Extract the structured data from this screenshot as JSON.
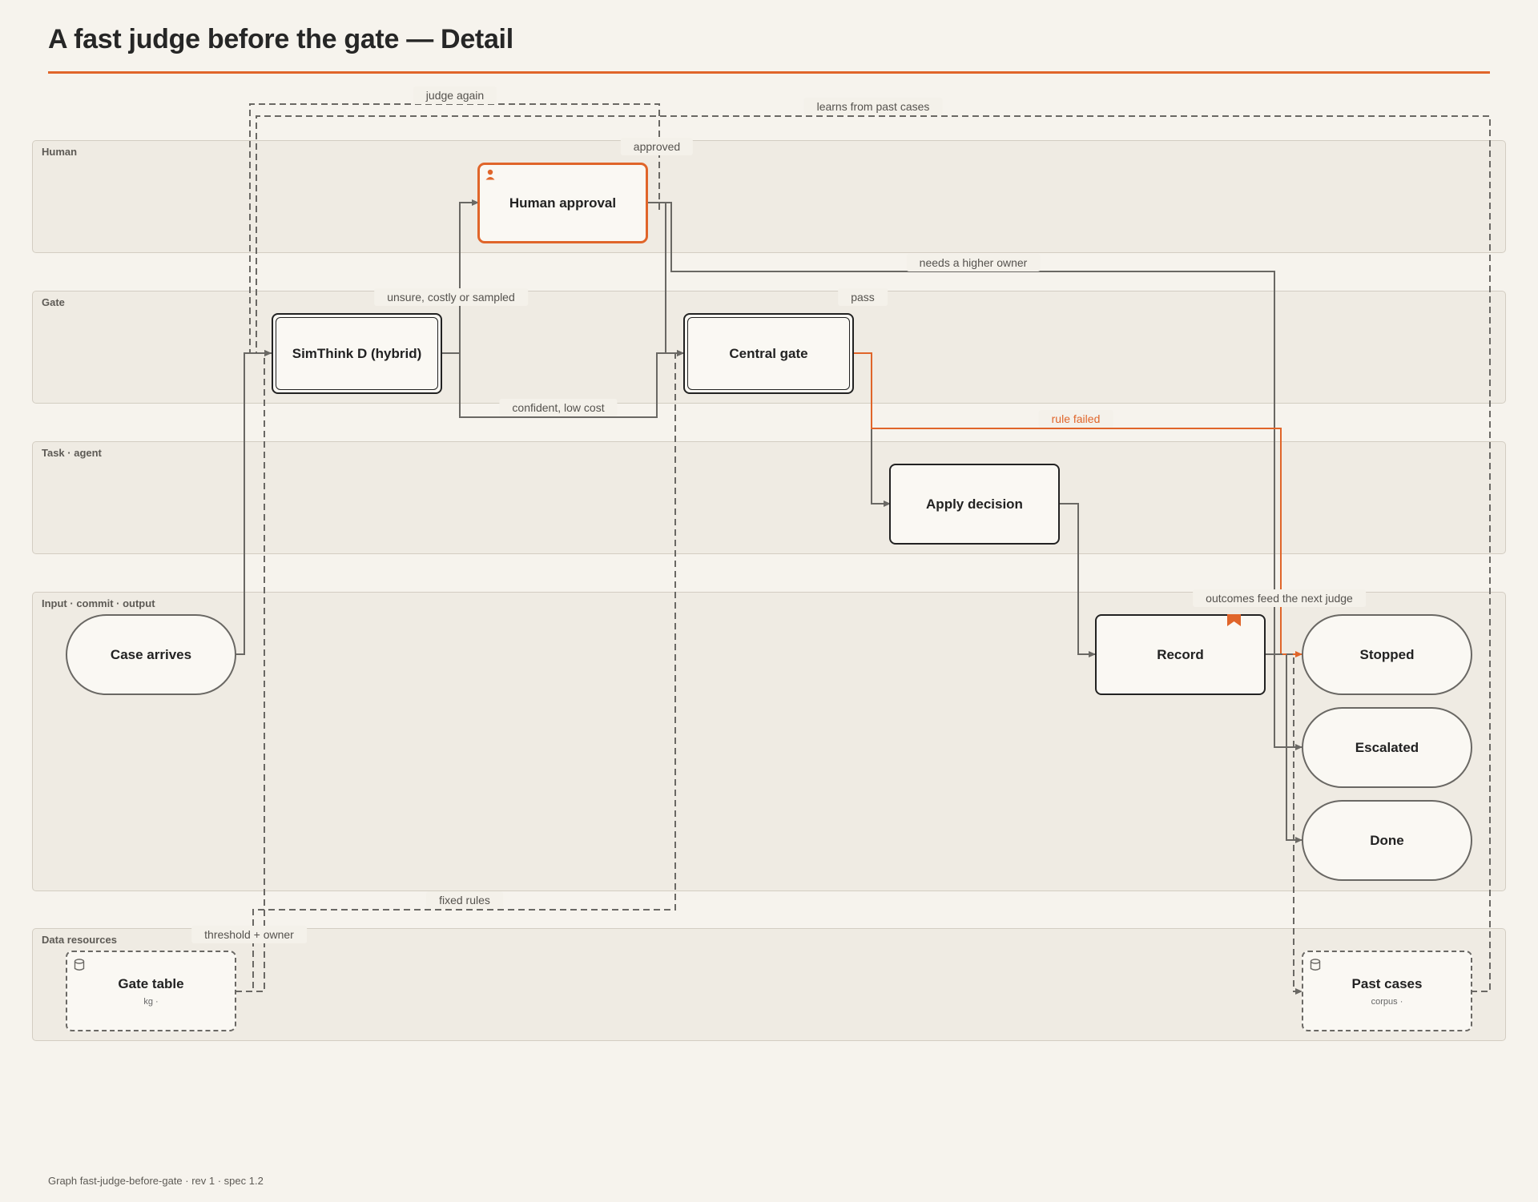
{
  "title": "A fast judge before the gate — Detail",
  "footer": "Graph fast-judge-before-gate · rev 1 · spec 1.2",
  "colors": {
    "accent": "#e0652a",
    "edge": "#6a6864",
    "lane": "#efebe3",
    "background": "#f6f3ed"
  },
  "lanes": [
    {
      "id": "human",
      "label": "Human"
    },
    {
      "id": "gate",
      "label": "Gate"
    },
    {
      "id": "task",
      "label": "Task · agent"
    },
    {
      "id": "io",
      "label": "Input · commit · output"
    },
    {
      "id": "data",
      "label": "Data resources"
    }
  ],
  "nodes": {
    "human_approval": {
      "label": "Human approval",
      "icon": "person-icon"
    },
    "simthink": {
      "label": "SimThink D (hybrid)"
    },
    "central_gate": {
      "label": "Central gate"
    },
    "apply_decision": {
      "label": "Apply decision"
    },
    "case_arrives": {
      "label": "Case arrives"
    },
    "record": {
      "label": "Record",
      "icon": "bookmark-icon"
    },
    "stopped": {
      "label": "Stopped"
    },
    "escalated": {
      "label": "Escalated"
    },
    "done": {
      "label": "Done"
    },
    "gate_table": {
      "label": "Gate table",
      "sub": "kg ·",
      "icon": "database-icon"
    },
    "past_cases": {
      "label": "Past cases",
      "sub": "corpus ·",
      "icon": "database-icon"
    }
  },
  "edge_labels": {
    "judge_again": "judge again",
    "learns": "learns from past cases",
    "approved": "approved",
    "needs_higher": "needs a higher owner",
    "unsure": "unsure, costly or sampled",
    "pass": "pass",
    "confident": "confident, low cost",
    "rule_failed": "rule failed",
    "outcomes": "outcomes feed the next judge",
    "fixed_rules": "fixed rules",
    "threshold": "threshold + owner"
  }
}
